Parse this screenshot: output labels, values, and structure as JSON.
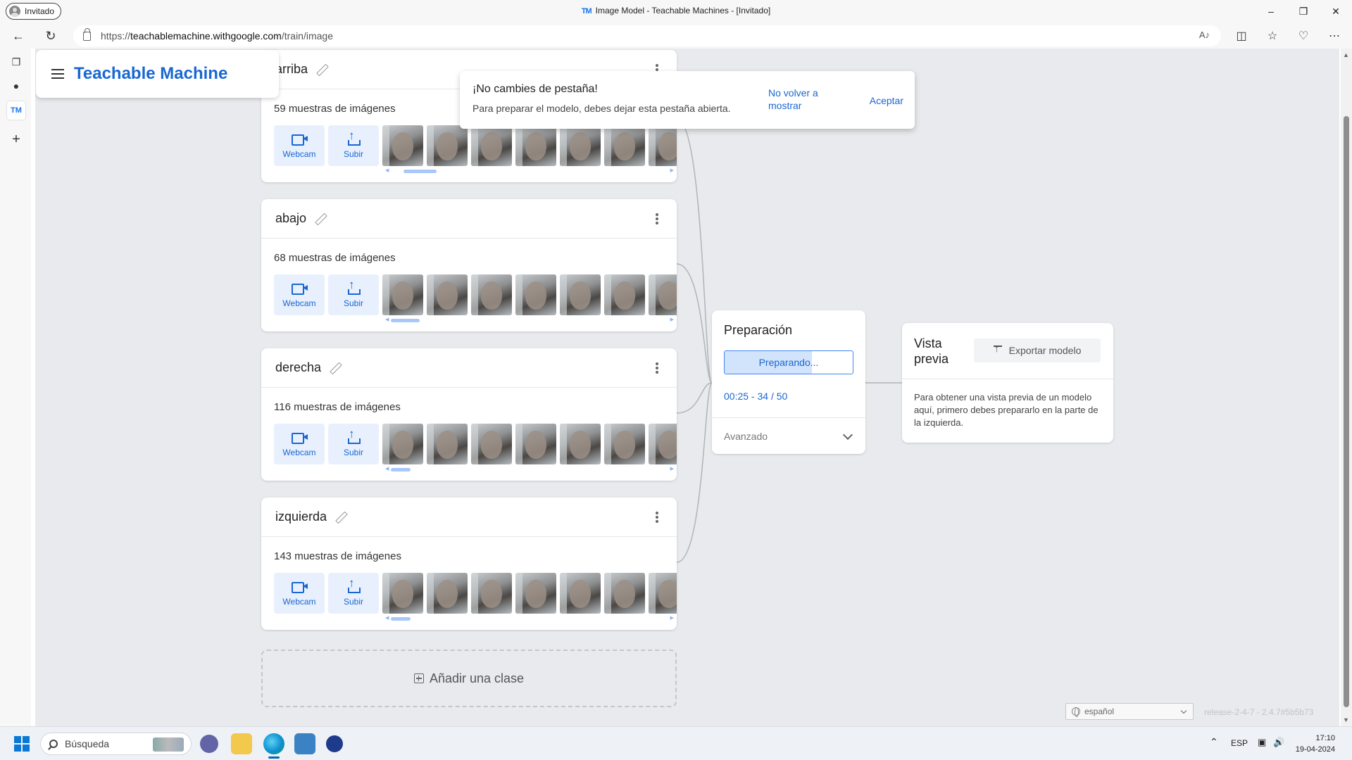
{
  "browser": {
    "profile_label": "Invitado",
    "window_title": "Image Model - Teachable Machines - [Invitado]",
    "favicon_text": "TM",
    "url_prefix": "https://",
    "url_host": "teachablemachine.withgoogle.com",
    "url_path": "/train/image",
    "read_aloud_label": "A♪"
  },
  "vertical_tabs": {
    "active_tab_text": "TM"
  },
  "app": {
    "brand": "Teachable Machine"
  },
  "toast": {
    "title": "¡No cambies de pestaña!",
    "message": "Para preparar el modelo, debes dejar esta pestaña abierta.",
    "dismiss_label": "No volver a mostrar",
    "accept_label": "Aceptar"
  },
  "classes": [
    {
      "name": "arriba",
      "samples": "59 muestras de imágenes",
      "webcam_label": "Webcam",
      "upload_label": "Subir",
      "scroll_position": 0.05
    },
    {
      "name": "abajo",
      "samples": "68 muestras de imágenes",
      "webcam_label": "Webcam",
      "upload_label": "Subir",
      "scroll_position": 0.0
    },
    {
      "name": "derecha",
      "samples": "116 muestras de imágenes",
      "webcam_label": "Webcam",
      "upload_label": "Subir",
      "scroll_position": 0.0
    },
    {
      "name": "izquierda",
      "samples": "143 muestras de imágenes",
      "webcam_label": "Webcam",
      "upload_label": "Subir",
      "scroll_position": 0.0
    }
  ],
  "add_class_label": "Añadir una clase",
  "training": {
    "title": "Preparación",
    "button_label": "Preparando...",
    "progress_fraction": 0.68,
    "progress_text": "00:25 - 34 / 50",
    "advanced_label": "Avanzado"
  },
  "preview": {
    "title": "Vista previa",
    "export_label": "Exportar modelo",
    "description": "Para obtener una vista previa de un modelo aquí, primero debes prepararlo en la parte de la izquierda."
  },
  "footer": {
    "language": "español",
    "release": "release-2-4-7 - 2.4.7#5b5b73"
  },
  "taskbar": {
    "search_placeholder": "Búsqueda",
    "lang_indicator": "ESP",
    "time": "17:10",
    "date": "19-04-2024"
  },
  "colors": {
    "accent": "#1967d2",
    "page_bg": "#e8eaed",
    "progress_fill": "#d2e3fc"
  }
}
